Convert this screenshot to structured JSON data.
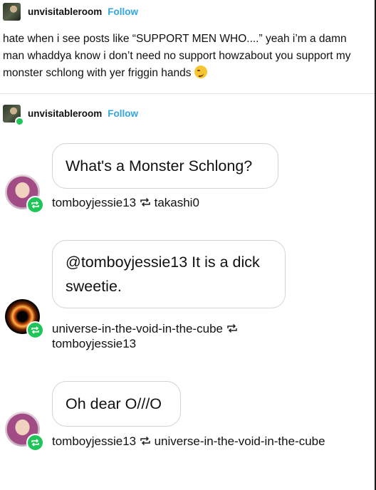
{
  "post1": {
    "username": "unvisitableroom",
    "follow_label": "Follow",
    "text_main": "hate when i see posts like “SUPPORT MEN WHO....” yeah i’m a damn man whaddya know i don’t need no support howzabout you support my monster schlong with yer friggin hands",
    "emoji_name": "smirking-face-emoji"
  },
  "post2": {
    "username": "unvisitableroom",
    "follow_label": "Follow"
  },
  "chat": [
    {
      "message": "What's a Monster Schlong?",
      "avatar": "jessie-avatar",
      "user": "tomboyjessie13",
      "reblogged_from": "takashi0"
    },
    {
      "message": "@tomboyjessie13 It is a dick sweetie.",
      "avatar": "black-hole-avatar",
      "user": "universe-in-the-void-in-the-cube",
      "reblogged_from": "tomboyjessie13"
    },
    {
      "message": "Oh dear O///O",
      "avatar": "jessie-avatar",
      "user": "tomboyjessie13",
      "reblogged_from": "universe-in-the-void-in-the-cube"
    }
  ],
  "colors": {
    "follow": "#2fa5e3",
    "reblog_badge": "#20c55a"
  }
}
